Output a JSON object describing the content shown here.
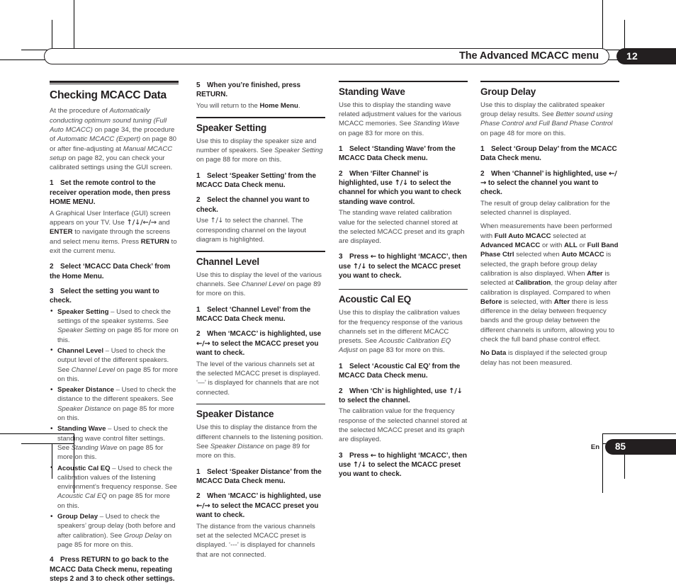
{
  "header": {
    "title": "The Advanced MCACC menu",
    "chapter_number": "12"
  },
  "footer": {
    "language_code": "En",
    "page_number": "85"
  },
  "columns": {
    "col1": {
      "heading": "Checking MCACC Data",
      "intro": "At the procedure of <em>Automatically conducting optimum sound tuning (Full Auto MCACC)</em> on page 34, the procedure of <em>Automatic MCACC (Expert)</em> on page 80 or after fine-adjusting at <em>Manual MCACC setup</em> on page 82, you can check your calibrated settings using the GUI screen.",
      "step1_num": "1",
      "step1": "Set the remote control to the receiver operation mode, then press HOME MENU.",
      "step1_body": "A Graphical User Interface (GUI) screen appears on your TV. Use <span class=\"arrow b\">↑/↓/←/→</span> and <b>ENTER</b> to navigate through the screens and select menu items. Press <b>RETURN</b> to exit the current menu.",
      "step2_num": "2",
      "step2": "Select ‘MCACC Data Check’ from the Home Menu.",
      "step3_num": "3",
      "step3": "Select the setting you want to check.",
      "bullets": [
        "<b>Speaker Setting</b> – Used to check the settings of the speaker systems. See <em>Speaker Setting</em> on page 85 for more on this.",
        "<b>Channel Level</b> – Used to check the output level of the different speakers. See <em>Channel Level</em> on page 85 for more on this.",
        "<b>Speaker Distance</b> – Used to check the distance to the different speakers. See <em>Speaker Distance</em> on page 85 for more on this.",
        "<b>Standing Wave</b> – Used to check the standing wave control filter settings. See <em>Standing Wave</em> on page 85 for more on this.",
        "<b>Acoustic Cal EQ</b> – Used to check the calibration values of the listening environment’s frequency response. See <em>Acoustic Cal EQ</em> on page 85 for more on this.",
        "<b>Group Delay</b> – Used to check the speakers’ group delay (both before and after calibration). See <em>Group Delay</em> on page 85 for more on this."
      ],
      "step4_num": "4",
      "step4": "Press RETURN to go back to the MCACC Data Check menu, repeating steps 2 and 3 to check other settings."
    },
    "col2": {
      "step5_num": "5",
      "step5": "When you’re finished, press RETURN.",
      "step5_body": "You will return to the <b>Home Menu</b>.",
      "speaker_setting": {
        "heading": "Speaker Setting",
        "intro": "Use this to display the speaker size and number of speakers. See <em>Speaker Setting</em> on page 88 for more on this.",
        "step1_num": "1",
        "step1": "Select ‘Speaker Setting’ from the MCACC Data Check menu.",
        "step2_num": "2",
        "step2": "Select the channel you want to check.",
        "step2_body": "Use <span class=\"arrow\">↑/↓</span> to select the channel. The corresponding channel on the layout diagram is highlighted."
      },
      "channel_level": {
        "heading": "Channel Level",
        "intro": "Use this to display the level of the various channels. See <em>Channel Level</em> on page 89 for more on this.",
        "step1_num": "1",
        "step1": "Select ‘Channel Level’ from the MCACC Data Check menu.",
        "step2_num": "2",
        "step2": "When ‘MCACC’ is highlighted, use <span class=\"arrow b\">←/→</span> to select the MCACC preset you want to check.",
        "step2_body": "The level of the various channels set at the selected MCACC preset is displayed. ‘—’ is displayed for channels that are not connected."
      },
      "speaker_distance": {
        "heading": "Speaker Distance",
        "intro": "Use this to display the distance from the different channels to the listening position. See <em>Speaker Distance</em> on page 89 for more on this.",
        "step1_num": "1",
        "step1": "Select ‘Speaker Distance’ from the MCACC Data Check menu.",
        "step2_num": "2",
        "step2": "When ‘MCACC’ is highlighted, use <span class=\"arrow b\">←/→</span> to select the MCACC preset you want to check.",
        "step2_body": "The distance from the various channels set at the selected MCACC preset is displayed. ‘---’ is displayed for channels that are not connected."
      }
    },
    "col3": {
      "standing_wave": {
        "heading": "Standing Wave",
        "intro": "Use this to display the standing wave related adjustment values for the various MCACC memories. See <em>Standing Wave</em> on page 83 for more on this.",
        "step1_num": "1",
        "step1": "Select ‘Standing Wave’ from the MCACC Data Check menu.",
        "step2_num": "2",
        "step2": "When ‘Filter Channel’ is highlighted, use <span class=\"arrow b\">↑/↓</span> to select the channel for which you want to check standing wave control.",
        "step2_body": "The standing wave related calibration value for the selected channel stored at the selected MCACC preset and its graph are displayed.",
        "step3_num": "3",
        "step3": "Press <span class=\"arrow b\">←</span> to highlight ‘MCACC’, then use <span class=\"arrow b\">↑/↓</span> to select the MCACC preset you want to check."
      },
      "acoustic_cal_eq": {
        "heading": "Acoustic Cal EQ",
        "intro": "Use this to display the calibration values for the frequency response of the various channels set in the different MCACC presets. See <em>Acoustic Calibration EQ Adjust</em> on page 83 for more on this.",
        "step1_num": "1",
        "step1": "Select ‘Acoustic Cal EQ’ from the MCACC Data Check menu.",
        "step2_num": "2",
        "step2": "When ‘Ch’ is highlighted, use <span class=\"arrow b\">↑/↓</span> to select the channel.",
        "step2_body": "The calibration value for the frequency response of the selected channel stored at the selected MCACC preset and its graph are displayed.",
        "step3_num": "3",
        "step3": "Press <span class=\"arrow b\">←</span> to highlight ‘MCACC’, then use <span class=\"arrow b\">↑/↓</span> to select the MCACC preset you want to check."
      }
    },
    "col4": {
      "group_delay": {
        "heading": "Group Delay",
        "intro": "Use this to display the calibrated speaker group delay results. See <em>Better sound using Phase Control and Full Band Phase Control</em> on page 48 for more on this.",
        "step1_num": "1",
        "step1": "Select ‘Group Delay’ from the MCACC Data Check menu.",
        "step2_num": "2",
        "step2": "When ‘Channel’ is highlighted, use <span class=\"arrow b\">←/→</span> to select the channel you want to check.",
        "body1": "The result of group delay calibration for the selected channel is displayed.",
        "body2": "When measurements have been performed with <b>Full Auto MCACC</b> selected at <b>Advanced MCACC</b> or with <b>ALL</b> or <b>Full Band Phase Ctrl</b> selected when <b>Auto MCACC</b> is selected, the graph before group delay calibration is also displayed. When <b>After</b> is selected at <b>Calibration</b>, the group delay after calibration is displayed. Compared to when <b>Before</b> is selected, with <b>After</b> there is less difference in the delay between frequency bands and the group delay between the different channels is uniform, allowing you to check the full band phase control effect.",
        "body3": "<b>No Data</b> is displayed if the selected group delay has not been measured."
      }
    }
  }
}
